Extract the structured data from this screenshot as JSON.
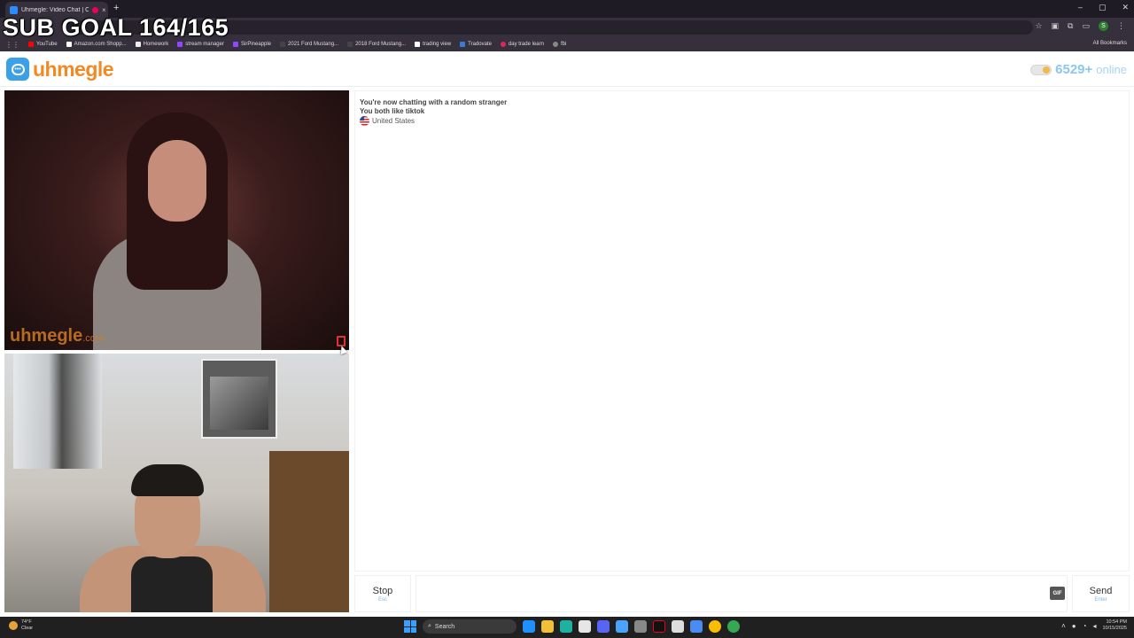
{
  "browser": {
    "tab_title": "Uhmegle: Video Chat | Om...",
    "tab_close": "×",
    "new_tab": "+",
    "window_controls": [
      "–",
      "▢",
      "✕"
    ],
    "bookmarks": [
      "YouTube",
      "Amazon.com Shopp...",
      "Homework",
      "stream manager",
      "SirPineapple",
      "2021 Ford Mustang...",
      "2018 Ford Mustang...",
      "trading view",
      "Tradovate",
      "day trade learn",
      "fbi"
    ],
    "all_bookmarks": "All Bookmarks",
    "profile_initial": "S"
  },
  "overlay": {
    "subgoal": "SUB GOAL 164/165"
  },
  "site": {
    "logo_text": "uhmegle",
    "online_count": "6529+",
    "online_label": "online"
  },
  "video": {
    "watermark_main": "uhmegle",
    "watermark_suffix": ".com"
  },
  "chat": {
    "messages": [
      "You're now chatting with a random stranger",
      "You both like tiktok"
    ],
    "country": "United States"
  },
  "controls": {
    "stop_label": "Stop",
    "stop_hint": "Esc",
    "gif_label": "GIF",
    "send_label": "Send",
    "send_hint": "Enter"
  },
  "taskbar": {
    "weather_temp": "74°F",
    "weather_desc": "Clear",
    "search_label": "Search",
    "time": "10:54 PM",
    "date": "10/15/2025"
  }
}
